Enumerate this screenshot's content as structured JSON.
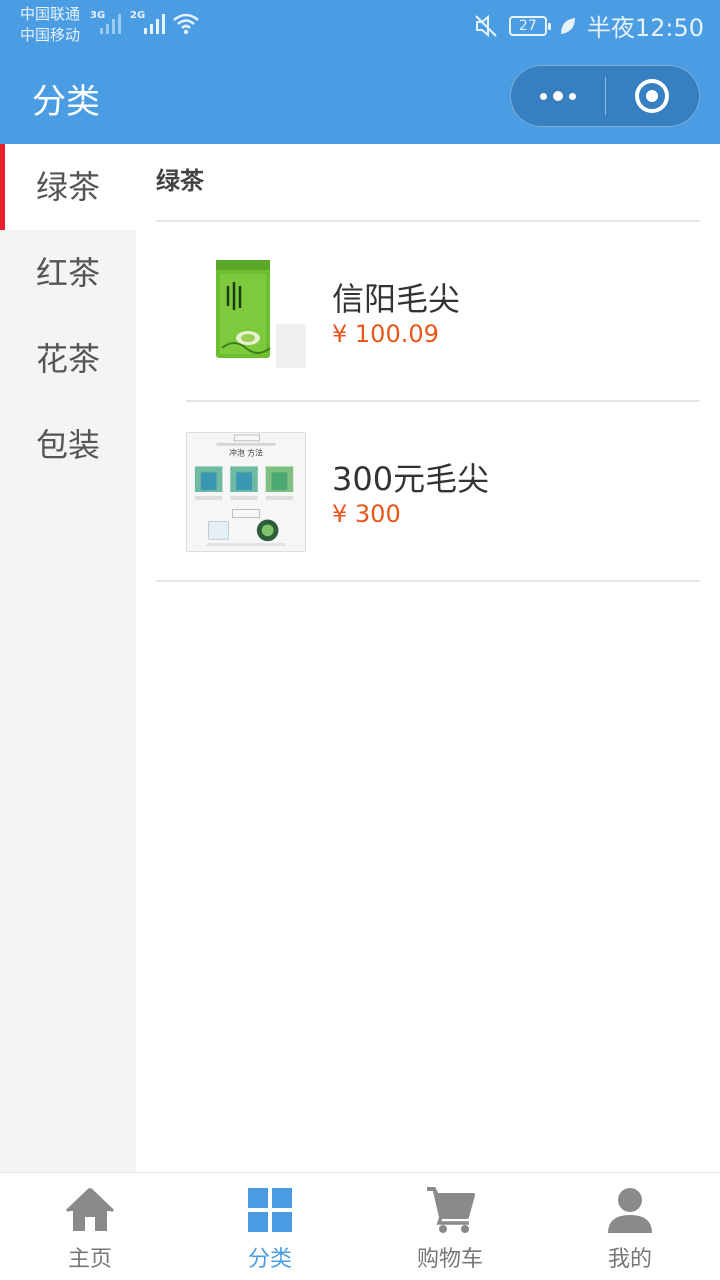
{
  "status_bar": {
    "carrier_1": "中国联通",
    "carrier_2": "中国移动",
    "net_1": "3G",
    "net_2": "2G",
    "battery": "27",
    "time": "半夜12:50"
  },
  "navbar": {
    "title": "分类"
  },
  "sidebar": {
    "items": [
      {
        "label": "绿茶",
        "active": true
      },
      {
        "label": "红茶",
        "active": false
      },
      {
        "label": "花茶",
        "active": false
      },
      {
        "label": "包装",
        "active": false
      }
    ]
  },
  "main": {
    "section_title": "绿茶",
    "products": [
      {
        "name": "信阳毛尖",
        "price": "¥ 100.09"
      },
      {
        "name": "300元毛尖",
        "price": "¥ 300"
      }
    ],
    "product_2_image_text": {
      "line1": "冲泡 方法"
    }
  },
  "tabbar": {
    "tabs": [
      {
        "label": "主页",
        "icon": "home-icon",
        "active": false
      },
      {
        "label": "分类",
        "icon": "category-grid-icon",
        "active": true
      },
      {
        "label": "购物车",
        "icon": "cart-icon",
        "active": false
      },
      {
        "label": "我的",
        "icon": "user-icon",
        "active": false
      }
    ]
  },
  "colors": {
    "primary": "#4a9de3",
    "active_indicator": "#e8202a",
    "price": "#e8561c",
    "sidebar_bg": "#f4f4f6"
  }
}
